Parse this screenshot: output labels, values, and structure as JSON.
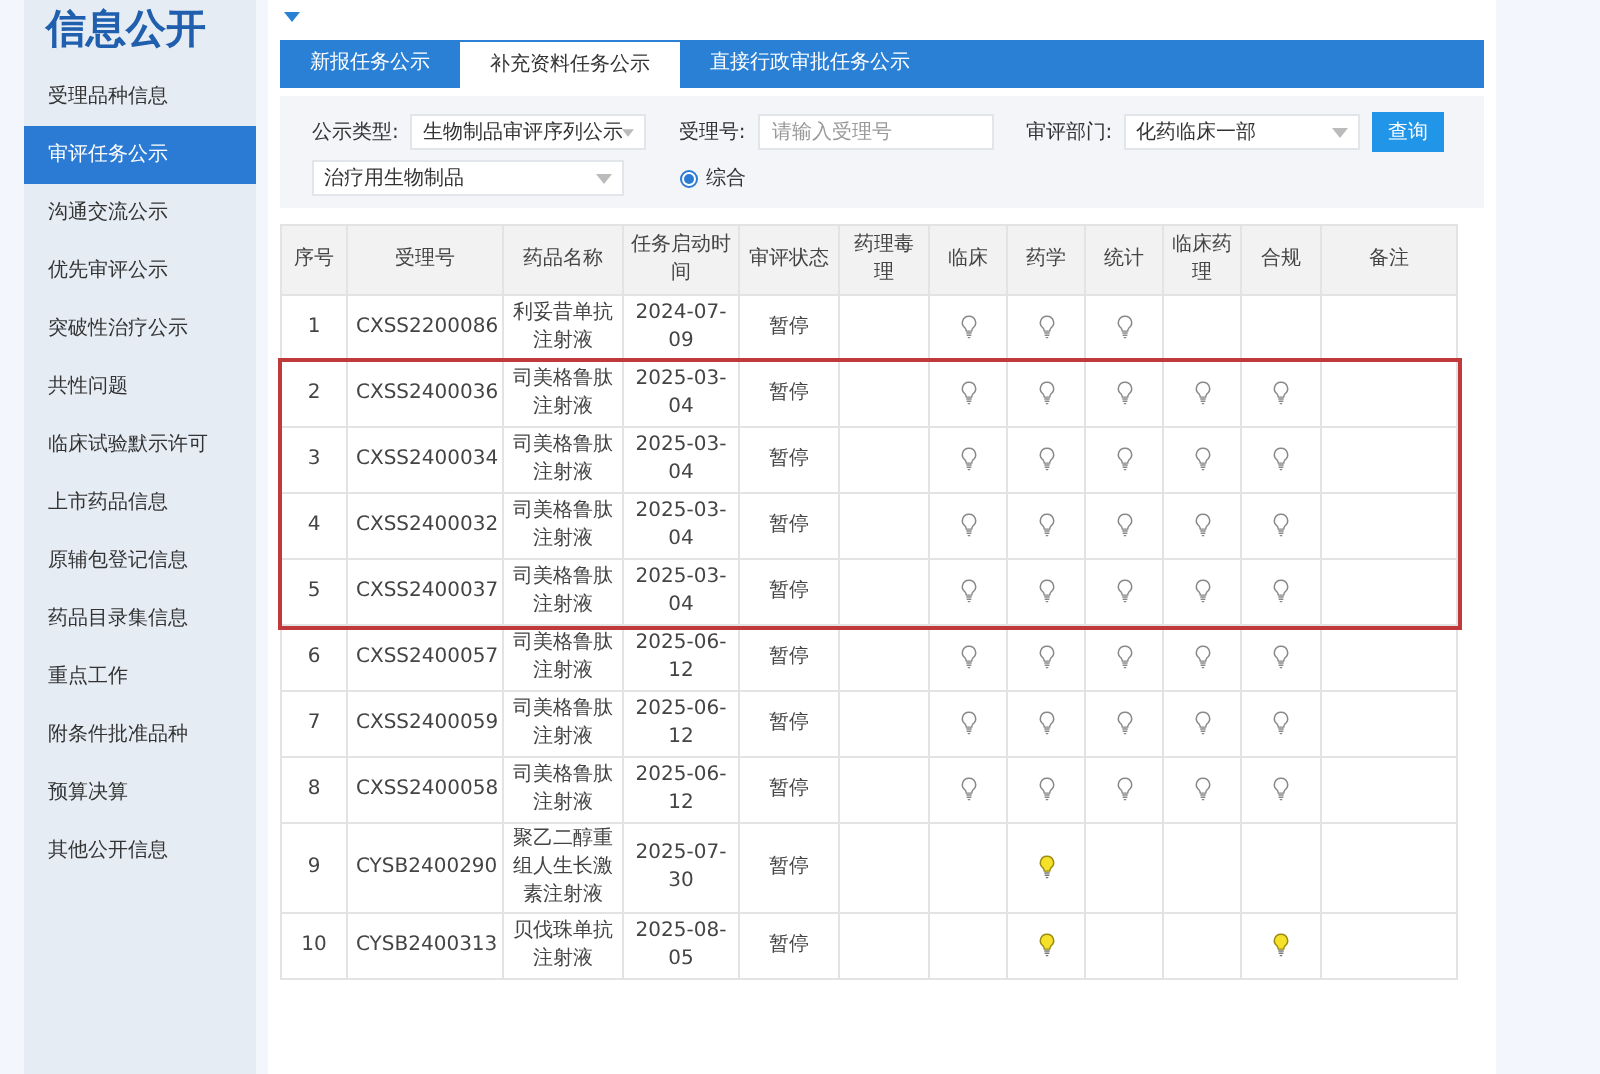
{
  "sidebar": {
    "title": "信息公开",
    "items": [
      {
        "label": "受理品种信息",
        "selected": false
      },
      {
        "label": "审评任务公示",
        "selected": true
      },
      {
        "label": "沟通交流公示",
        "selected": false
      },
      {
        "label": "优先审评公示",
        "selected": false
      },
      {
        "label": "突破性治疗公示",
        "selected": false
      },
      {
        "label": "共性问题",
        "selected": false
      },
      {
        "label": "临床试验默示许可",
        "selected": false
      },
      {
        "label": "上市药品信息",
        "selected": false
      },
      {
        "label": "原辅包登记信息",
        "selected": false
      },
      {
        "label": "药品目录集信息",
        "selected": false
      },
      {
        "label": "重点工作",
        "selected": false
      },
      {
        "label": "附条件批准品种",
        "selected": false
      },
      {
        "label": "预算决算",
        "selected": false
      },
      {
        "label": "其他公开信息",
        "selected": false
      }
    ]
  },
  "tabs": [
    {
      "label": "新报任务公示",
      "selected": false
    },
    {
      "label": "补充资料任务公示",
      "selected": true
    },
    {
      "label": "直接行政审批任务公示",
      "selected": false
    }
  ],
  "filters": {
    "type_label": "公示类型:",
    "type_value": "生物制品审评序列公示",
    "number_label": "受理号:",
    "number_placeholder": "请输入受理号",
    "dept_label": "审评部门:",
    "dept_value": "化药临床一部",
    "search_button": "查询",
    "subtype_value": "治疗用生物制品",
    "radio": {
      "label": "综合",
      "selected": true
    }
  },
  "table": {
    "columns": [
      "序号",
      "受理号",
      "药品名称",
      "任务启动时间",
      "审评状态",
      "药理毒理",
      "临床",
      "药学",
      "统计",
      "临床药理",
      "合规",
      "备注"
    ],
    "rows": [
      {
        "no": "1",
        "number": "CXSS2200086",
        "drug": "利妥昔单抗注射液",
        "date": "2024-07-09",
        "status": "暂停",
        "highlighted": false,
        "bulbs": [
          {
            "kind": "empty"
          },
          {
            "kind": "bulb",
            "lit": false
          },
          {
            "kind": "bulb",
            "lit": false
          },
          {
            "kind": "bulb",
            "lit": false
          },
          {
            "kind": "empty"
          },
          {
            "kind": "empty"
          }
        ]
      },
      {
        "no": "2",
        "number": "CXSS2400036",
        "drug": "司美格鲁肽注射液",
        "date": "2025-03-04",
        "status": "暂停",
        "highlighted": true,
        "bulbs": [
          {
            "kind": "empty"
          },
          {
            "kind": "bulb",
            "lit": false
          },
          {
            "kind": "bulb",
            "lit": false
          },
          {
            "kind": "bulb",
            "lit": false
          },
          {
            "kind": "bulb",
            "lit": false
          },
          {
            "kind": "bulb",
            "lit": false
          }
        ]
      },
      {
        "no": "3",
        "number": "CXSS2400034",
        "drug": "司美格鲁肽注射液",
        "date": "2025-03-04",
        "status": "暂停",
        "highlighted": true,
        "bulbs": [
          {
            "kind": "empty"
          },
          {
            "kind": "bulb",
            "lit": false
          },
          {
            "kind": "bulb",
            "lit": false
          },
          {
            "kind": "bulb",
            "lit": false
          },
          {
            "kind": "bulb",
            "lit": false
          },
          {
            "kind": "bulb",
            "lit": false
          }
        ]
      },
      {
        "no": "4",
        "number": "CXSS2400032",
        "drug": "司美格鲁肽注射液",
        "date": "2025-03-04",
        "status": "暂停",
        "highlighted": true,
        "bulbs": [
          {
            "kind": "empty"
          },
          {
            "kind": "bulb",
            "lit": false
          },
          {
            "kind": "bulb",
            "lit": false
          },
          {
            "kind": "bulb",
            "lit": false
          },
          {
            "kind": "bulb",
            "lit": false
          },
          {
            "kind": "bulb",
            "lit": false
          }
        ]
      },
      {
        "no": "5",
        "number": "CXSS2400037",
        "drug": "司美格鲁肽注射液",
        "date": "2025-03-04",
        "status": "暂停",
        "highlighted": true,
        "bulbs": [
          {
            "kind": "empty"
          },
          {
            "kind": "bulb",
            "lit": false
          },
          {
            "kind": "bulb",
            "lit": false
          },
          {
            "kind": "bulb",
            "lit": false
          },
          {
            "kind": "bulb",
            "lit": false
          },
          {
            "kind": "bulb",
            "lit": false
          }
        ]
      },
      {
        "no": "6",
        "number": "CXSS2400057",
        "drug": "司美格鲁肽注射液",
        "date": "2025-06-12",
        "status": "暂停",
        "highlighted": false,
        "bulbs": [
          {
            "kind": "empty"
          },
          {
            "kind": "bulb",
            "lit": false
          },
          {
            "kind": "bulb",
            "lit": false
          },
          {
            "kind": "bulb",
            "lit": false
          },
          {
            "kind": "bulb",
            "lit": false
          },
          {
            "kind": "bulb",
            "lit": false
          }
        ]
      },
      {
        "no": "7",
        "number": "CXSS2400059",
        "drug": "司美格鲁肽注射液",
        "date": "2025-06-12",
        "status": "暂停",
        "highlighted": false,
        "bulbs": [
          {
            "kind": "empty"
          },
          {
            "kind": "bulb",
            "lit": false
          },
          {
            "kind": "bulb",
            "lit": false
          },
          {
            "kind": "bulb",
            "lit": false
          },
          {
            "kind": "bulb",
            "lit": false
          },
          {
            "kind": "bulb",
            "lit": false
          }
        ]
      },
      {
        "no": "8",
        "number": "CXSS2400058",
        "drug": "司美格鲁肽注射液",
        "date": "2025-06-12",
        "status": "暂停",
        "highlighted": false,
        "bulbs": [
          {
            "kind": "empty"
          },
          {
            "kind": "bulb",
            "lit": false
          },
          {
            "kind": "bulb",
            "lit": false
          },
          {
            "kind": "bulb",
            "lit": false
          },
          {
            "kind": "bulb",
            "lit": false
          },
          {
            "kind": "bulb",
            "lit": false
          }
        ]
      },
      {
        "no": "9",
        "number": "CYSB2400290",
        "drug": "聚乙二醇重组人生长激素注射液",
        "date": "2025-07-30",
        "status": "暂停",
        "highlighted": false,
        "bulbs": [
          {
            "kind": "empty"
          },
          {
            "kind": "empty"
          },
          {
            "kind": "bulb",
            "lit": true
          },
          {
            "kind": "empty"
          },
          {
            "kind": "empty"
          },
          {
            "kind": "empty"
          }
        ]
      },
      {
        "no": "10",
        "number": "CYSB2400313",
        "drug": "贝伐珠单抗注射液",
        "date": "2025-08-05",
        "status": "暂停",
        "highlighted": false,
        "bulbs": [
          {
            "kind": "empty"
          },
          {
            "kind": "empty"
          },
          {
            "kind": "bulb",
            "lit": true
          },
          {
            "kind": "empty"
          },
          {
            "kind": "empty"
          },
          {
            "kind": "bulb",
            "lit": true
          }
        ]
      }
    ]
  }
}
